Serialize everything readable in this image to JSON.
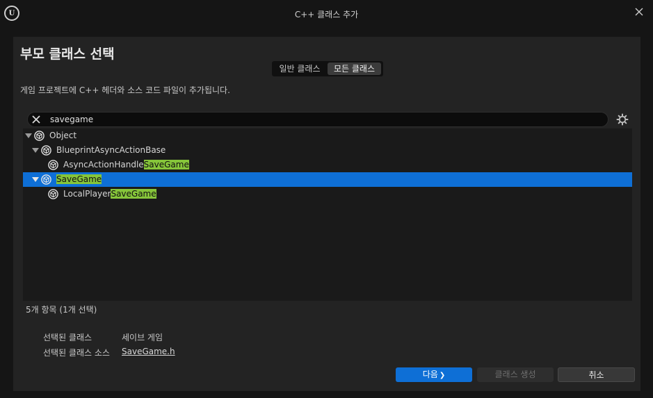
{
  "window": {
    "title": "C++ 클래스 추가",
    "logo_text": "U"
  },
  "page": {
    "heading": "부모 클래스 선택",
    "tabs": [
      {
        "label": "일반 클래스",
        "selected": false
      },
      {
        "label": "모든 클래스",
        "selected": true
      }
    ],
    "description": "게임 프로젝트에 C++ 헤더와 소스 코드 파일이 추가됩니다."
  },
  "search": {
    "value": "savegame"
  },
  "tree": {
    "rows": [
      {
        "prefix": "Object",
        "match": "",
        "suffix": ""
      },
      {
        "prefix": "BlueprintAsyncActionBase",
        "match": "",
        "suffix": ""
      },
      {
        "prefix": "AsyncActionHandle",
        "match": "SaveGame",
        "suffix": ""
      },
      {
        "prefix": "",
        "match": "SaveGame",
        "suffix": ""
      },
      {
        "prefix": "LocalPlayer",
        "match": "SaveGame",
        "suffix": ""
      }
    ]
  },
  "status": {
    "count": "5개 항목 (1개 선택)"
  },
  "info": {
    "selected_class_label": "선택된 클래스",
    "selected_class_value": "세이브 게임",
    "selected_source_label": "선택된 클래스 소스",
    "selected_source_value": "SaveGame.h"
  },
  "buttons": {
    "next": "다음",
    "next_glyph": "❯",
    "create": "클래스 생성",
    "cancel": "취소"
  },
  "colors": {
    "accent": "#0e6fd6",
    "highlight": "#86c53a"
  }
}
